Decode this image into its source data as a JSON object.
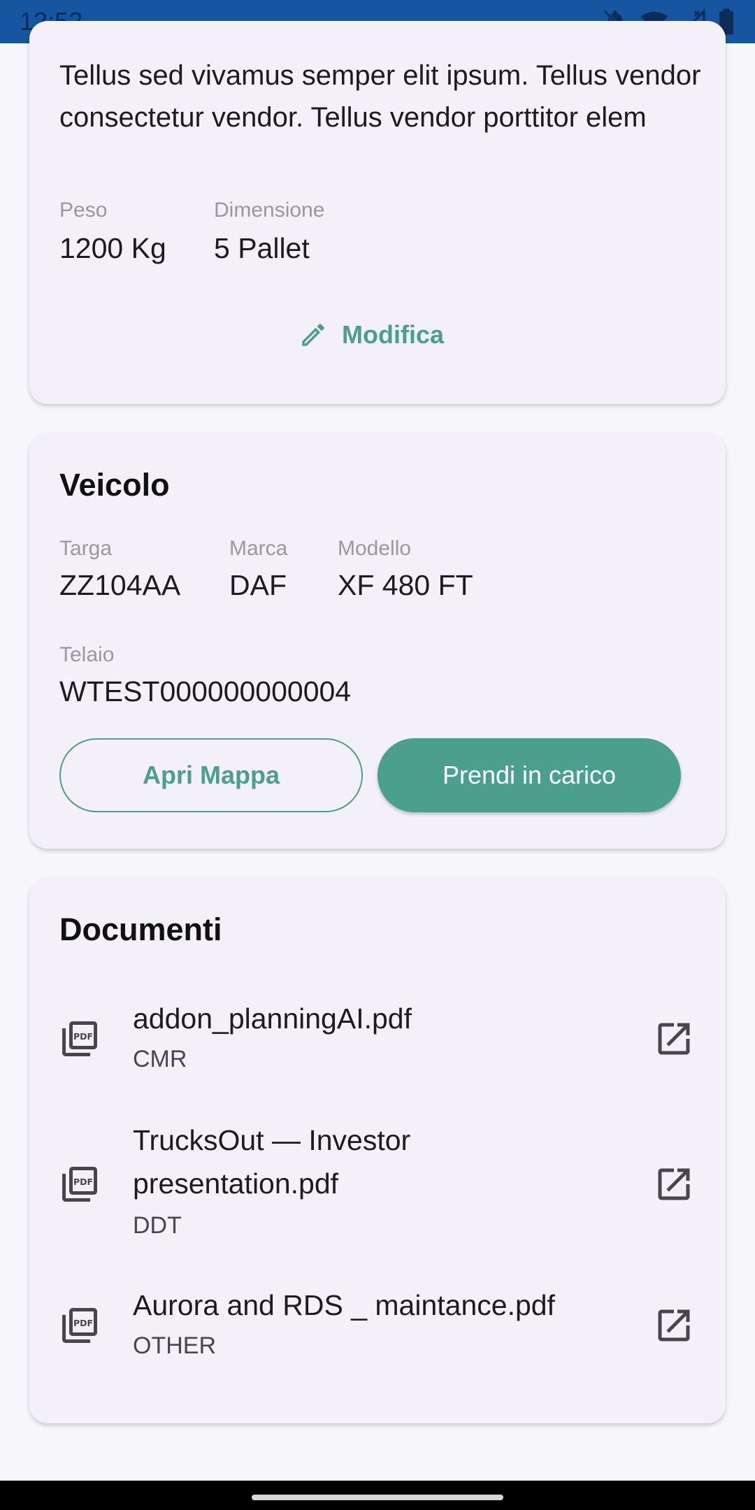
{
  "status_bar": {
    "time": "12:52",
    "icons": [
      "bell-off-icon",
      "wifi-icon",
      "signal-icon",
      "battery-icon"
    ]
  },
  "cargo": {
    "description": "Tellus sed vivamus semper elit ipsum. Tellus vendor consectetur vendor. Tellus vendor porttitor elem",
    "fields": [
      {
        "label": "Peso",
        "value": "1200 Kg"
      },
      {
        "label": "Dimensione",
        "value": "5 Pallet"
      }
    ],
    "edit_label": "Modifica"
  },
  "vehicle": {
    "title": "Veicolo",
    "fields": [
      {
        "label": "Targa",
        "value": "ZZ104AA"
      },
      {
        "label": "Marca",
        "value": "DAF"
      },
      {
        "label": "Modello",
        "value": "XF 480 FT"
      },
      {
        "label": "Telaio",
        "value": "WTEST000000000004"
      }
    ],
    "open_map_label": "Apri Mappa",
    "take_charge_label": "Prendi in carico"
  },
  "documents": {
    "title": "Documenti",
    "items": [
      {
        "name": "addon_planningAI.pdf",
        "type": "CMR"
      },
      {
        "name": "TrucksOut — Investor presentation.pdf",
        "type": "DDT"
      },
      {
        "name": "Aurora and RDS _ maintance.pdf",
        "type": "OTHER"
      }
    ]
  },
  "colors": {
    "accent": "#4aa08b",
    "status_bar": "#1656a0",
    "card_bg": "#f4f0f7"
  }
}
